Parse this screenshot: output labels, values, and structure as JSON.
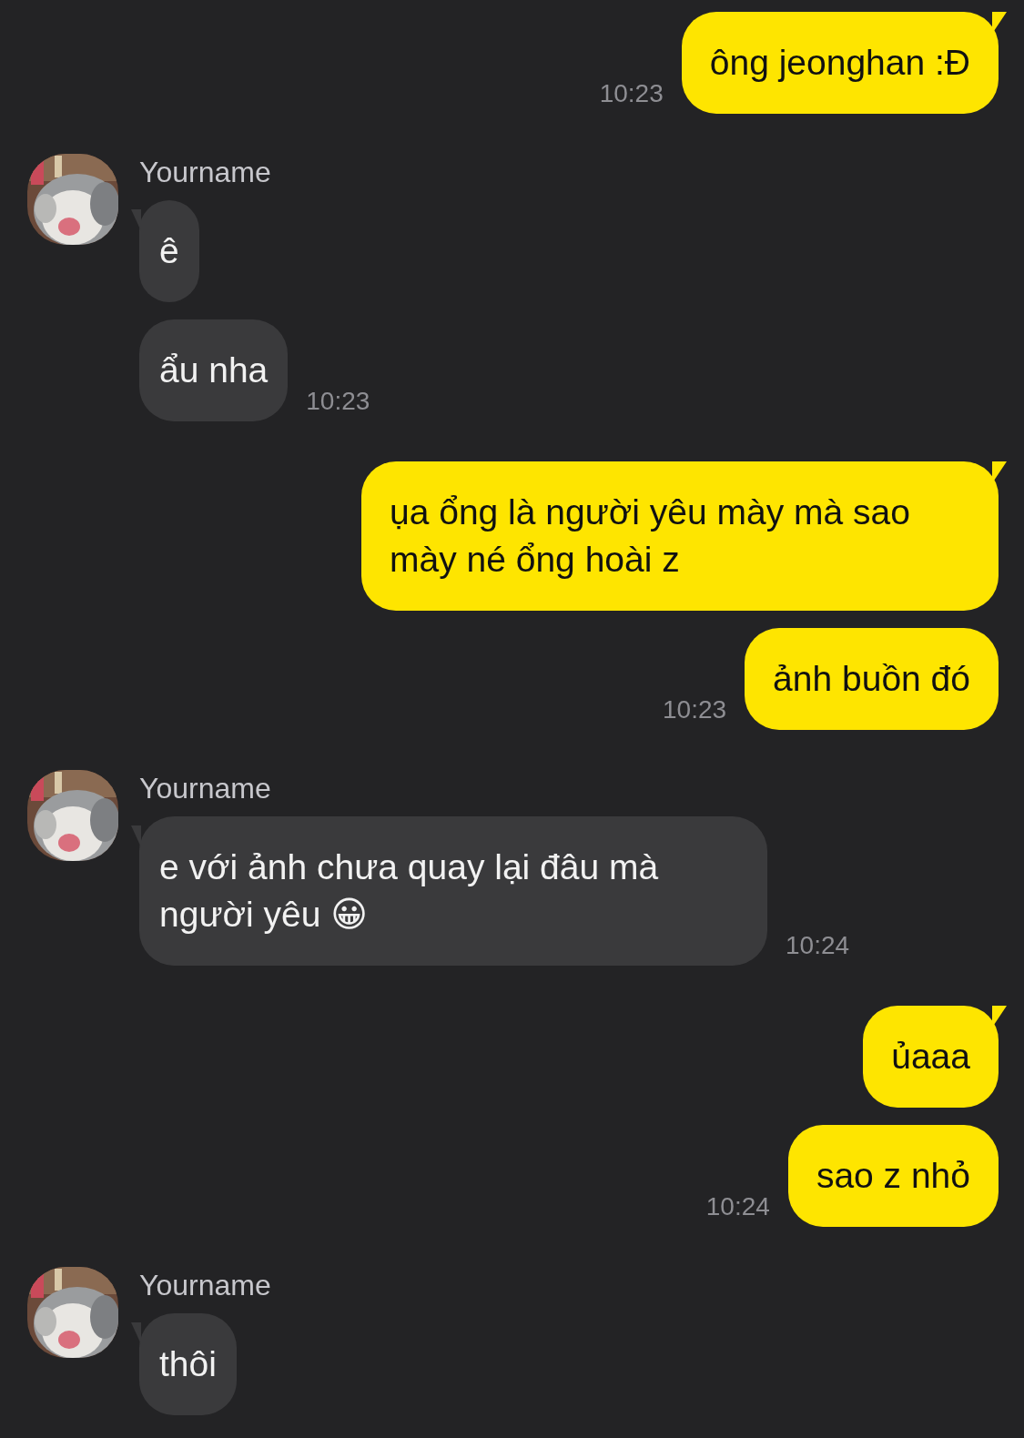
{
  "messages": [
    {
      "kind": "sent",
      "bubbles": [
        {
          "text": "ông jeonghan :Đ"
        }
      ],
      "time": "10:23"
    },
    {
      "kind": "received",
      "sender": "Yourname",
      "avatar": {
        "kind": "picture"
      },
      "bubbles": [
        {
          "text": "ê"
        },
        {
          "text": "ẩu nha"
        }
      ],
      "time": "10:23"
    },
    {
      "kind": "sent",
      "bubbles": [
        {
          "text": "ụa ổng là người yêu mày mà sao mày né ổng hoài z"
        },
        {
          "text": "ảnh buồn đó"
        }
      ],
      "time": "10:23"
    },
    {
      "kind": "received",
      "sender": "Yourname",
      "avatar": {
        "kind": "picture"
      },
      "bubbles": [
        {
          "text": "e với ảnh chưa quay lại đâu mà người yêu 😀"
        }
      ],
      "time": "10:24"
    },
    {
      "kind": "sent",
      "bubbles": [
        {
          "text": "ủaaa"
        },
        {
          "text": "sao z nhỏ"
        }
      ],
      "time": "10:24"
    },
    {
      "kind": "received",
      "sender": "Yourname",
      "avatar": {
        "kind": "picture"
      },
      "bubbles": [
        {
          "text": "thôi"
        }
      ]
    }
  ]
}
